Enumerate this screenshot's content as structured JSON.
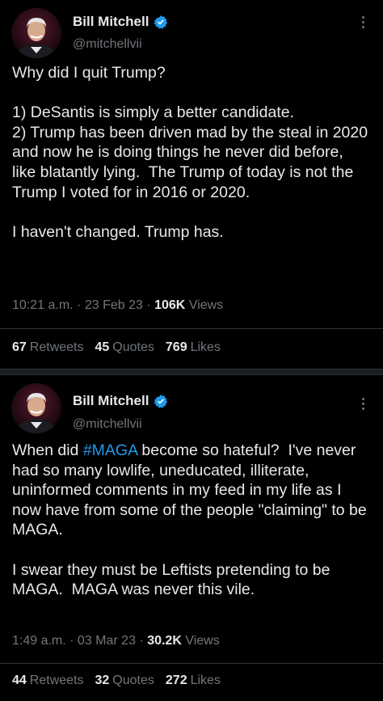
{
  "tweets": [
    {
      "author": {
        "name": "Bill Mitchell",
        "handle": "@mitchellvii"
      },
      "text_intro": "Why did I quit Trump?\n\n1) DeSantis is simply a better candidate.\n2) Trump has been driven mad by the steal in 2020 and now he is doing things he never did before, like blatantly lying.  The Trump of today is not the Trump I voted for in 2016 or 2020.\n\nI haven't changed. Trump has.",
      "time": "10:21 a.m.",
      "date": "23 Feb 23",
      "views_count": "106K",
      "views_label": "Views",
      "retweets_count": "67",
      "retweets_label": "Retweets",
      "quotes_count": "45",
      "quotes_label": "Quotes",
      "likes_count": "769",
      "likes_label": "Likes"
    },
    {
      "author": {
        "name": "Bill Mitchell",
        "handle": "@mitchellvii"
      },
      "text_before_tag": "When did ",
      "hashtag": "#MAGA",
      "text_after_tag": " become so hateful?  I've never had so many lowlife, uneducated, illiterate, uninformed comments in my feed in my life as I now have from some of the people \"claiming\" to be MAGA.\n\nI swear they must be Leftists pretending to be MAGA.  MAGA was never this vile.",
      "time": "1:49 a.m.",
      "date": "03 Mar 23",
      "views_count": "30.2K",
      "views_label": "Views",
      "retweets_count": "44",
      "retweets_label": "Retweets",
      "quotes_count": "32",
      "quotes_label": "Quotes",
      "likes_count": "272",
      "likes_label": "Likes"
    }
  ],
  "colors": {
    "background": "#000000",
    "text": "#e7e9ea",
    "secondary": "#71767b",
    "accent": "#1d9bf0"
  },
  "icons": {
    "verified": "verified-badge-icon",
    "more": "more-options-icon"
  }
}
